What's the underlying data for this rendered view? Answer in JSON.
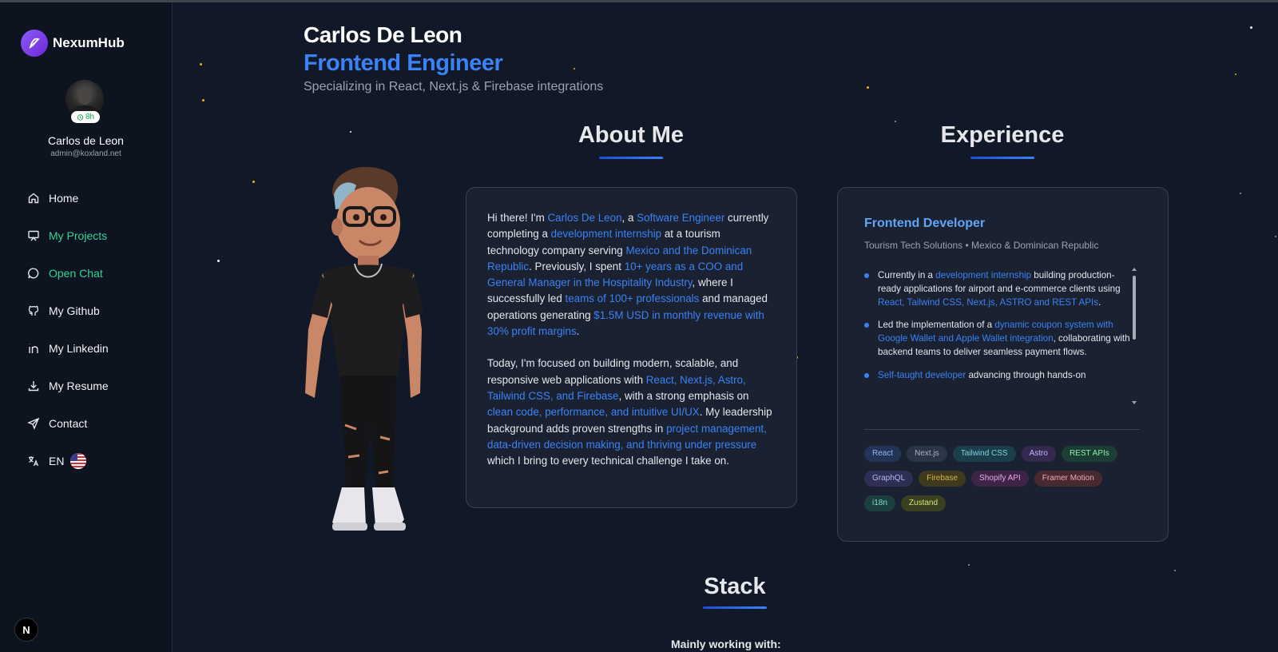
{
  "brand": {
    "name": "NexumHub"
  },
  "user": {
    "name": "Carlos de Leon",
    "email": "admin@koxland.net",
    "timer": "8h"
  },
  "nav": {
    "items": [
      {
        "label": "Home",
        "icon": "home-icon"
      },
      {
        "label": "My Projects",
        "icon": "presentation-icon",
        "active": true
      },
      {
        "label": "Open Chat",
        "icon": "chat-bubble-icon",
        "active": true
      },
      {
        "label": "My Github",
        "icon": "github-icon"
      },
      {
        "label": "My Linkedin",
        "icon": "linkedin-icon"
      },
      {
        "label": "My Resume",
        "icon": "download-icon"
      },
      {
        "label": "Contact",
        "icon": "send-icon"
      },
      {
        "label": "EN",
        "icon": "translate-icon",
        "flag": "us-flag-icon"
      }
    ]
  },
  "hero": {
    "name": "Carlos De Leon",
    "role": "Frontend Engineer",
    "subtitle": "Specializing in React, Next.js & Firebase integrations"
  },
  "about": {
    "title": "About Me",
    "p1": [
      {
        "t": "Hi there! I'm "
      },
      {
        "t": "Carlos De Leon",
        "hl": true
      },
      {
        "t": ", a "
      },
      {
        "t": "Software Engineer",
        "hl": true
      },
      {
        "t": " currently completing a "
      },
      {
        "t": "development internship",
        "hl": true
      },
      {
        "t": " at a tourism technology company serving "
      },
      {
        "t": "Mexico and the Dominican Republic",
        "hl": true
      },
      {
        "t": ". Previously, I spent "
      },
      {
        "t": "10+ years as a COO and General Manager in the Hospitality Industry",
        "hl": true
      },
      {
        "t": ", where I successfully led "
      },
      {
        "t": "teams of 100+ professionals",
        "hl": true
      },
      {
        "t": " and managed operations generating "
      },
      {
        "t": "$1.5M USD in monthly revenue with 30% profit margins",
        "hl": true
      },
      {
        "t": "."
      }
    ],
    "p2": [
      {
        "t": "Today, I'm focused on building modern, scalable, and responsive web applications with "
      },
      {
        "t": "React, Next.js, Astro, Tailwind CSS, and Firebase",
        "hl": true
      },
      {
        "t": ", with a strong emphasis on "
      },
      {
        "t": "clean code, performance, and intuitive UI/UX",
        "hl": true
      },
      {
        "t": ". My leadership background adds proven strengths in "
      },
      {
        "t": "project management, data-driven decision making, and thriving under pressure",
        "hl": true
      },
      {
        "t": " which I bring to every technical challenge I take on."
      }
    ]
  },
  "experience": {
    "title": "Experience",
    "job_title": "Frontend Developer",
    "company": "Tourism Tech Solutions • Mexico & Dominican Republic",
    "items": [
      [
        {
          "t": "Currently in a "
        },
        {
          "t": "development internship",
          "hl": true
        },
        {
          "t": " building production-ready applications for airport and e-commerce clients using "
        },
        {
          "t": "React, Tailwind CSS, Next.js, ASTRO and REST APIs",
          "hl": true
        },
        {
          "t": "."
        }
      ],
      [
        {
          "t": "Led the implementation of a "
        },
        {
          "t": "dynamic coupon system with Google Wallet and Apple Wallet integration",
          "hl": true
        },
        {
          "t": ", collaborating with backend teams to deliver seamless payment flows."
        }
      ],
      [
        {
          "t": "Self-taught developer",
          "hl": true
        },
        {
          "t": " advancing through hands-on"
        }
      ]
    ],
    "tags": [
      {
        "label": "React",
        "bg": "#243456",
        "fg": "#93b4f5"
      },
      {
        "label": "Next.js",
        "bg": "#2a3547",
        "fg": "#a5b4c8"
      },
      {
        "label": "Tailwind CSS",
        "bg": "#1b3f4a",
        "fg": "#7dd3e0"
      },
      {
        "label": "Astro",
        "bg": "#35294f",
        "fg": "#c4b5fd"
      },
      {
        "label": "REST APIs",
        "bg": "#1c3d33",
        "fg": "#86efac"
      },
      {
        "label": "GraphQL",
        "bg": "#2f2f55",
        "fg": "#b3b7f5"
      },
      {
        "label": "Firebase",
        "bg": "#3f3a1e",
        "fg": "#d9b44a"
      },
      {
        "label": "Shopify API",
        "bg": "#3e2545",
        "fg": "#e9a8e8"
      },
      {
        "label": "Framer Motion",
        "bg": "#472a31",
        "fg": "#f4a9b2"
      },
      {
        "label": "i18n",
        "bg": "#1c3f40",
        "fg": "#7fdcd3"
      },
      {
        "label": "Zustand",
        "bg": "#39401f",
        "fg": "#d4e27a"
      }
    ]
  },
  "stack": {
    "title": "Stack",
    "subtitle": "Mainly working with:"
  },
  "footer_badge": "N"
}
